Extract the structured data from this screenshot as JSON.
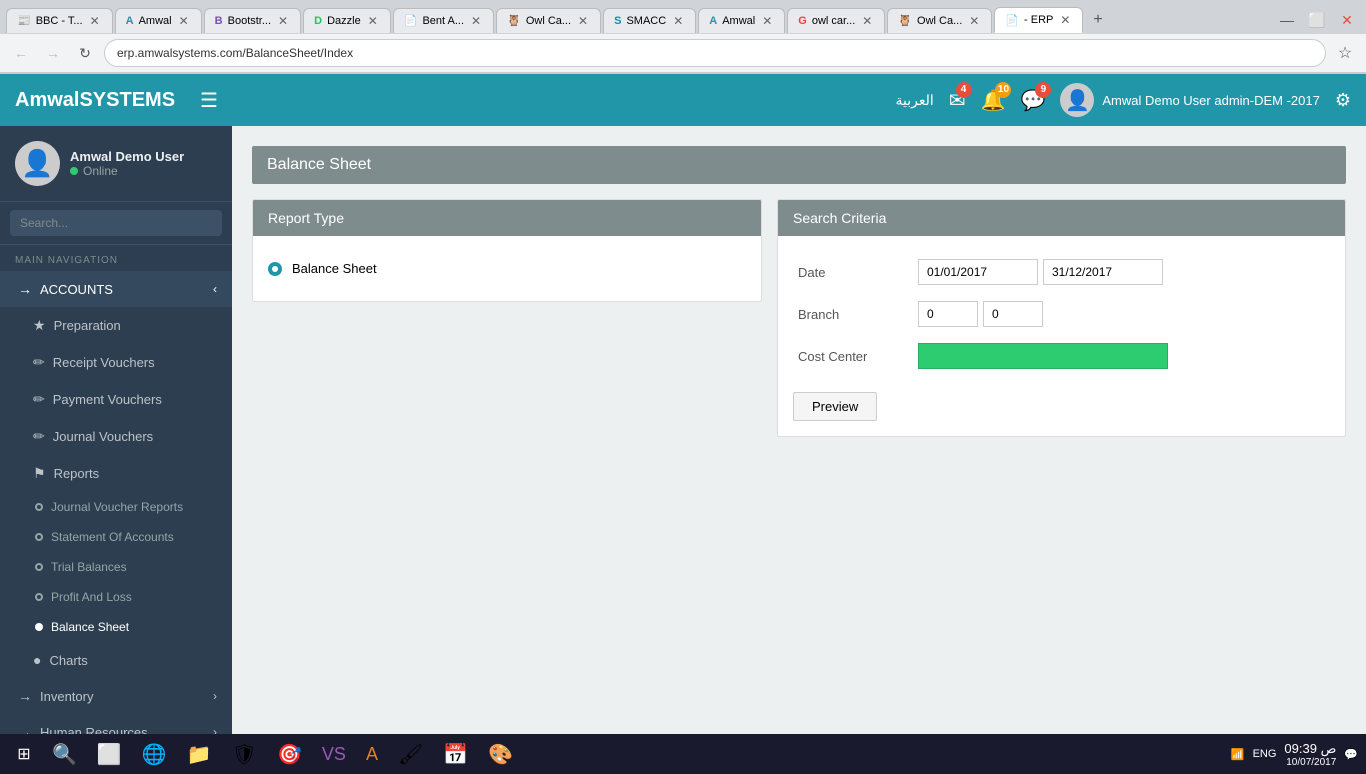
{
  "browser": {
    "tabs": [
      {
        "label": "BBC - T...",
        "favicon": "📰",
        "active": false
      },
      {
        "label": "Amwal",
        "favicon": "A",
        "active": false
      },
      {
        "label": "Bootstr...",
        "favicon": "B",
        "active": false
      },
      {
        "label": "Dazzle",
        "favicon": "D",
        "active": false
      },
      {
        "label": "Bent A...",
        "favicon": "📄",
        "active": false
      },
      {
        "label": "Owl Ca...",
        "favicon": "🦉",
        "active": false
      },
      {
        "label": "SMACC",
        "favicon": "S",
        "active": false
      },
      {
        "label": "Amwal",
        "favicon": "A",
        "active": false
      },
      {
        "label": "owl car...",
        "favicon": "G",
        "active": false
      },
      {
        "label": "Owl Ca...",
        "favicon": "🦉",
        "active": false
      },
      {
        "label": "- ERP",
        "favicon": "📄",
        "active": true
      }
    ],
    "address": "erp.amwalsystems.com/BalanceSheet/Index"
  },
  "topnav": {
    "brand": "AmwalSYSTEMS",
    "hamburger_label": "☰",
    "arabic_label": "العربية",
    "mail_count": "4",
    "bell_count": "10",
    "chat_count": "9",
    "user_name": "Amwal Demo User admin-DEM -2017",
    "settings_icon": "⚙"
  },
  "sidebar": {
    "user_name": "Amwal Demo User",
    "status": "Online",
    "search_placeholder": "Search...",
    "nav_label": "MAIN NAVIGATION",
    "accounts_label": "ACCOUNTS",
    "nav_items": [
      {
        "label": "Preparation",
        "icon": "★",
        "type": "sub"
      },
      {
        "label": "Receipt Vouchers",
        "icon": "○",
        "type": "sub"
      },
      {
        "label": "Payment Vouchers",
        "icon": "○",
        "type": "sub"
      },
      {
        "label": "Journal Vouchers",
        "icon": "○",
        "type": "sub"
      },
      {
        "label": "Reports",
        "icon": "⚑",
        "type": "parent"
      },
      {
        "label": "Journal Voucher Reports",
        "type": "subsub"
      },
      {
        "label": "Statement Of Accounts",
        "type": "subsub"
      },
      {
        "label": "Trial Balances",
        "type": "subsub"
      },
      {
        "label": "Profit And Loss",
        "type": "subsub"
      },
      {
        "label": "Balance Sheet",
        "type": "subsub",
        "active": true
      },
      {
        "label": "Charts",
        "icon": "●",
        "type": "sub"
      },
      {
        "label": "Inventory",
        "icon": "→",
        "type": "sub"
      },
      {
        "label": "Human Resources",
        "icon": "→",
        "type": "sub"
      }
    ]
  },
  "content": {
    "page_title": "Balance Sheet",
    "report_type_panel": {
      "header": "Report Type",
      "options": [
        {
          "label": "Balance Sheet",
          "selected": true
        }
      ]
    },
    "search_criteria_panel": {
      "header": "Search Criteria",
      "fields": [
        {
          "label": "Date",
          "inputs": [
            {
              "value": "01/01/2017",
              "type": "date"
            },
            {
              "value": "31/12/2017",
              "type": "date"
            }
          ]
        },
        {
          "label": "Branch",
          "inputs": [
            {
              "value": "0",
              "type": "text"
            },
            {
              "value": "0",
              "type": "text"
            }
          ]
        },
        {
          "label": "Cost Center",
          "inputs": [
            {
              "value": "",
              "type": "text",
              "style": "green"
            }
          ]
        }
      ],
      "preview_button": "Preview"
    }
  },
  "taskbar": {
    "apps": [
      "⊞",
      "🔍",
      "⬜",
      "🌐",
      "📁",
      "🛡",
      "🎯",
      "🖌",
      "💻",
      "📸",
      "🔧"
    ],
    "system_tray": {
      "lang": "ENG",
      "time": "09:39 ص",
      "date": "10/07/2017"
    }
  }
}
